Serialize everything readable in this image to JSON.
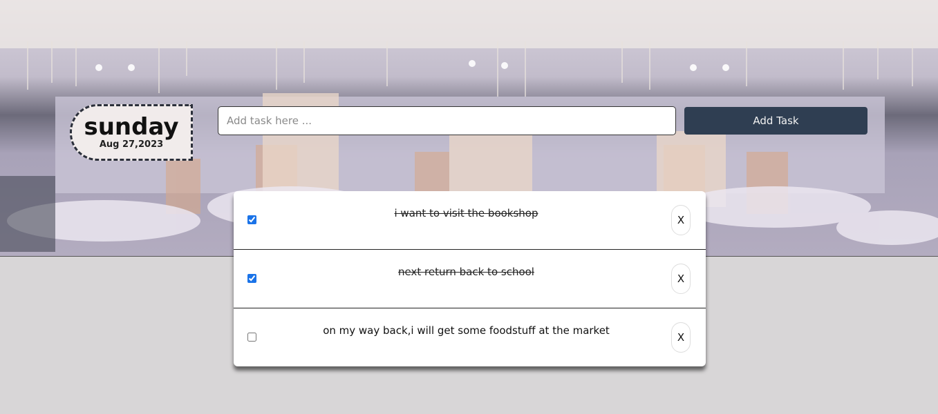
{
  "header": {
    "day_name": "sunday",
    "date": "Aug 27,2023"
  },
  "form": {
    "input_placeholder": "Add task here ...",
    "input_value": "",
    "add_button_label": "Add Task"
  },
  "tasks": [
    {
      "text": "i want to visit the bookshop",
      "completed": true,
      "delete_label": "X"
    },
    {
      "text": "next return back to school",
      "completed": true,
      "delete_label": "X"
    },
    {
      "text": "on my way back,i will get some foodstuff at the market",
      "completed": false,
      "delete_label": "X"
    }
  ],
  "colors": {
    "accent_button": "#2f3e52",
    "page_background": "#d8d6d7",
    "checkbox": "#1a73e8"
  }
}
